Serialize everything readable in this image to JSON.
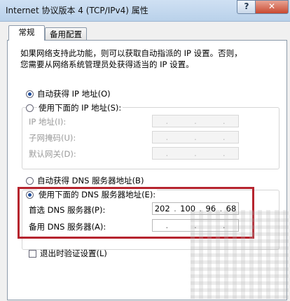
{
  "window": {
    "title": "Internet 协议版本 4 (TCP/IPv4) 属性",
    "help_label": "?",
    "close_label": "✕"
  },
  "tabs": [
    {
      "label": "常规"
    },
    {
      "label": "备用配置"
    }
  ],
  "description": {
    "line1": "如果网络支持此功能，则可以获取自动指派的 IP 设置。否则，",
    "line2": "您需要从网络系统管理员处获得适当的 IP 设置。"
  },
  "ip_section": {
    "auto_label": "自动获得 IP 地址(O)",
    "manual_label": "使用下面的 IP 地址(S):",
    "auto_selected": true,
    "fields": [
      {
        "label": "IP 地址(I):",
        "value": ". . ."
      },
      {
        "label": "子网掩码(U):",
        "value": ". . ."
      },
      {
        "label": "默认网关(D):",
        "value": ". . ."
      }
    ]
  },
  "dns_section": {
    "auto_label": "自动获得 DNS 服务器地址(B)",
    "manual_label": "使用下面的 DNS 服务器地址(E):",
    "manual_selected": true,
    "preferred_label": "首选 DNS 服务器(P):",
    "preferred_octets": [
      "202",
      "100",
      "96",
      "68"
    ],
    "alternate_label": "备用 DNS 服务器(A):",
    "alternate_octets": [
      "",
      "",
      "",
      ""
    ]
  },
  "validate_checkbox": {
    "label": "退出时验证设置(L)",
    "checked": false
  },
  "colors": {
    "highlight": "#b6242e",
    "radio_dot": "#1e4d9c"
  }
}
